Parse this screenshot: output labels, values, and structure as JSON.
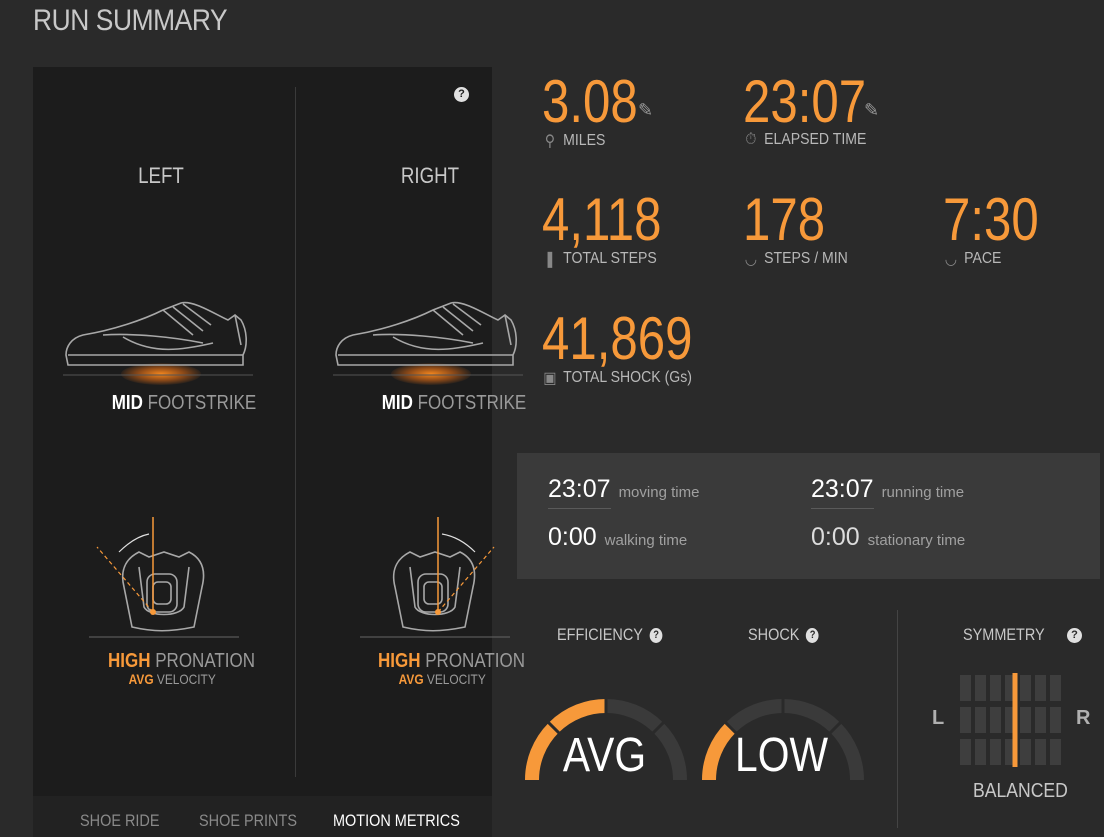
{
  "page": {
    "title": "RUN SUMMARY"
  },
  "colors": {
    "accent": "#f7993a",
    "panel": "#1c1c1c",
    "background": "#2a2a2a"
  },
  "feet": {
    "left": {
      "label": "LEFT",
      "strike_level": "MID",
      "strike_word": "FOOTSTRIKE",
      "pronation_level": "HIGH",
      "pronation_word": "PRONATION",
      "velocity_level": "AVG",
      "velocity_word": "VELOCITY"
    },
    "right": {
      "label": "RIGHT",
      "strike_level": "MID",
      "strike_word": "FOOTSTRIKE",
      "pronation_level": "HIGH",
      "pronation_word": "PRONATION",
      "velocity_level": "AVG",
      "velocity_word": "VELOCITY"
    },
    "help_icon": "question-icon"
  },
  "tabs": [
    {
      "label": "SHOE RIDE",
      "active": false
    },
    {
      "label": "SHOE PRINTS",
      "active": false
    },
    {
      "label": "MOTION METRICS",
      "active": true
    }
  ],
  "metrics": {
    "miles": {
      "value": "3.08",
      "label": "MILES",
      "icon": "location-pin-icon",
      "editable": true
    },
    "elapsed": {
      "value": "23:07",
      "label": "ELAPSED TIME",
      "icon": "stopwatch-icon",
      "editable": true
    },
    "steps": {
      "value": "4,118",
      "label": "TOTAL STEPS",
      "icon": "footprints-icon"
    },
    "cadence": {
      "value": "178",
      "label": "STEPS / MIN",
      "icon": "speedometer-icon"
    },
    "pace": {
      "value": "7:30",
      "label": "PACE",
      "icon": "speedometer-icon"
    },
    "shock": {
      "value": "41,869",
      "label": "TOTAL SHOCK (Gs)",
      "icon": "impact-icon"
    }
  },
  "times": {
    "moving": {
      "value": "23:07",
      "label": "moving time"
    },
    "running": {
      "value": "23:07",
      "label": "running time"
    },
    "walking": {
      "value": "0:00",
      "label": "walking time"
    },
    "stationary": {
      "value": "0:00",
      "label": "stationary time"
    }
  },
  "gauges": {
    "efficiency": {
      "title": "EFFICIENCY",
      "value": "AVG",
      "fill_fraction": 0.5
    },
    "shock": {
      "title": "SHOCK",
      "value": "LOW",
      "fill_fraction": 0.25
    }
  },
  "symmetry": {
    "title": "SYMMETRY",
    "left": "L",
    "right": "R",
    "status": "BALANCED",
    "balance_fraction": 0.5
  }
}
